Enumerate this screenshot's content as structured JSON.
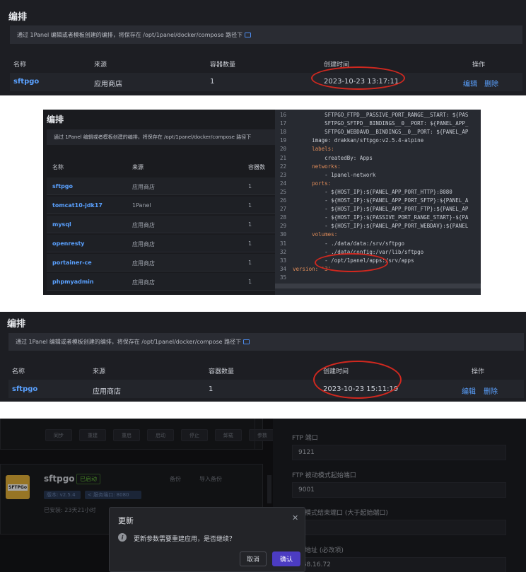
{
  "top": {
    "title": "编排",
    "info": "通过 1Panel 编辑或者模板创建的编排，将保存在 /opt/1panel/docker/compose 路径下",
    "columns": [
      "名称",
      "来源",
      "容器数量",
      "创建时间",
      "操作"
    ],
    "row": {
      "name": "sftpgo",
      "source": "应用商店",
      "count": "1",
      "time": "2023-10-23 13:17:11",
      "edit": "编辑",
      "delete": "删除"
    }
  },
  "mid": {
    "title": "编排",
    "info": "通过 1Panel 编辑或者模板创建的编排，将保存在 /opt/1panel/docker/compose 路径下",
    "columns": [
      "名称",
      "来源",
      "容器数"
    ],
    "rows": [
      {
        "name": "sftpgo",
        "source": "应用商店",
        "count": "1"
      },
      {
        "name": "tomcat10-jdk17",
        "source": "1Panel",
        "count": "1"
      },
      {
        "name": "mysql",
        "source": "应用商店",
        "count": "1"
      },
      {
        "name": "openresty",
        "source": "应用商店",
        "count": "1"
      },
      {
        "name": "portainer-ce",
        "source": "应用商店",
        "count": "1"
      },
      {
        "name": "phpmyadmin",
        "source": "应用商店",
        "count": "1"
      }
    ],
    "code": [
      {
        "n": "16",
        "t": "          SFTPGO_FTPD__PASSIVE_PORT_RANGE__START: ${PAS"
      },
      {
        "n": "17",
        "t": "          SFTPGO_SFTPD__BINDINGS__0__PORT: ${PANEL_APP_"
      },
      {
        "n": "18",
        "t": "          SFTPGO_WEBDAVD__BINDINGS__0__PORT: ${PANEL_AP"
      },
      {
        "n": "19",
        "t": "      image: drakkan/sftpgo:v2.5.4-alpine"
      },
      {
        "n": "20",
        "t": "      labels:"
      },
      {
        "n": "21",
        "t": "          createdBy: Apps"
      },
      {
        "n": "22",
        "t": "      networks:"
      },
      {
        "n": "23",
        "t": "          - 1panel-network"
      },
      {
        "n": "24",
        "t": "      ports:"
      },
      {
        "n": "25",
        "t": "          - ${HOST_IP}:${PANEL_APP_PORT_HTTP}:8080"
      },
      {
        "n": "26",
        "t": "          - ${HOST_IP}:${PANEL_APP_PORT_SFTP}:${PANEL_A"
      },
      {
        "n": "27",
        "t": "          - ${HOST_IP}:${PANEL_APP_PORT_FTP}:${PANEL_AP"
      },
      {
        "n": "28",
        "t": "          - ${HOST_IP}:${PASSIVE_PORT_RANGE_START}-${PA"
      },
      {
        "n": "29",
        "t": "          - ${HOST_IP}:${PANEL_APP_PORT_WEBDAV}:${PANEL"
      },
      {
        "n": "30",
        "t": "      volumes:"
      },
      {
        "n": "31",
        "t": "          - ./data/data:/srv/sftpgo"
      },
      {
        "n": "32",
        "t": "          - ./data/config:/var/lib/sftpgo"
      },
      {
        "n": "33",
        "t": "          - /opt/1panel/apps:/srv/apps"
      },
      {
        "n": "34",
        "t": "version: '3'"
      },
      {
        "n": "35",
        "t": ""
      }
    ]
  },
  "bottom": {
    "title": "编排",
    "info": "通过 1Panel 编辑或者模板创建的编排，将保存在 /opt/1panel/docker/compose 路径下",
    "columns": [
      "名称",
      "来源",
      "容器数量",
      "创建时间",
      "操作"
    ],
    "row": {
      "name": "sftpgo",
      "source": "应用商店",
      "count": "1",
      "time": "2023-10-23 15:11:19",
      "edit": "编辑",
      "delete": "删除"
    }
  },
  "app": {
    "toolbar": [
      "同步",
      "重建",
      "重启",
      "启动",
      "停止",
      "卸载",
      "参数"
    ],
    "name": "sftpgo",
    "status": "已启动",
    "actions": [
      "备份",
      "导入备份"
    ],
    "version": "版本: v2.5.4",
    "port": "< 服务端口: 8080",
    "installed": "已安装: 23天21小时",
    "logo": "SFTPGo",
    "form": [
      {
        "label": "FTP 端口",
        "value": "9121"
      },
      {
        "label": "FTP 被动模式起始端口",
        "value": "9001"
      },
      {
        "label": "被动模式结束端口 (大于起始端口)",
        "value": "2"
      },
      {
        "label": "外部地址 (必改项)",
        "value": "168.16.72"
      }
    ]
  },
  "dialog": {
    "title": "更新",
    "message": "更新参数需要重建应用，是否继续？",
    "cancel": "取消",
    "confirm": "确认"
  }
}
